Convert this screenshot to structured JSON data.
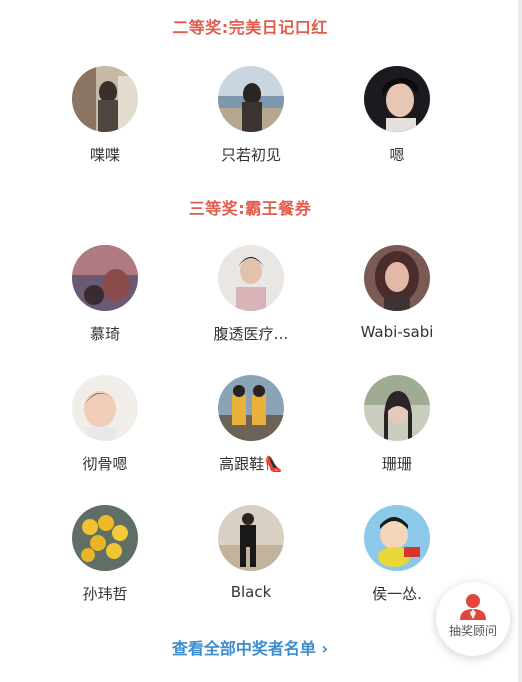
{
  "sections": [
    {
      "title": "二等奖:完美日记口红",
      "winners": [
        {
          "name": "喋喋",
          "avatar": "photo-avatar"
        },
        {
          "name": "只若初见",
          "avatar": "photo-avatar"
        },
        {
          "name": "嗯",
          "avatar": "photo-avatar"
        }
      ]
    },
    {
      "title": "三等奖:霸王餐券",
      "winners": [
        {
          "name": "慕琦",
          "avatar": "photo-avatar"
        },
        {
          "name": "腹透医疗…",
          "avatar": "photo-avatar"
        },
        {
          "name": "Wabi-sabi",
          "avatar": "photo-avatar"
        },
        {
          "name": "彻骨嗯",
          "avatar": "photo-avatar"
        },
        {
          "name": "高跟鞋👠",
          "avatar": "photo-avatar"
        },
        {
          "name": "珊珊",
          "avatar": "photo-avatar"
        },
        {
          "name": "孙玮哲",
          "avatar": "photo-avatar"
        },
        {
          "name": "Black",
          "avatar": "photo-avatar"
        },
        {
          "name": "侯一怂.",
          "avatar": "cartoon-avatar"
        }
      ]
    }
  ],
  "view_all_link": "查看全部中奖者名单 ›",
  "advisor_button": {
    "label": "抽奖顾问",
    "icon": "person-icon"
  },
  "colors": {
    "section_title": "#e25c4c",
    "link": "#3c8dd0",
    "advisor_icon": "#e0463a"
  }
}
